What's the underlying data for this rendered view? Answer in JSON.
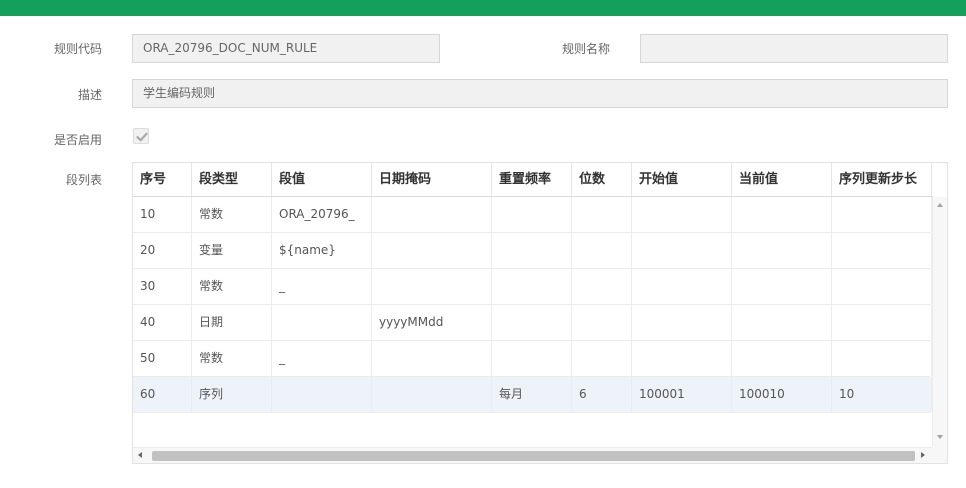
{
  "colors": {
    "accent": "#13a05a"
  },
  "form": {
    "rule_code_label": "规则代码",
    "rule_code_value": "ORA_20796_DOC_NUM_RULE",
    "rule_name_label": "规则名称",
    "rule_name_value": "",
    "description_label": "描述",
    "description_value": "学生编码规则",
    "enabled_label": "是否启用",
    "enabled_checked": true,
    "segments_label": "段列表"
  },
  "table": {
    "columns": [
      "序号",
      "段类型",
      "段值",
      "日期掩码",
      "重置频率",
      "位数",
      "开始值",
      "当前值",
      "序列更新步长"
    ],
    "rows": [
      [
        "10",
        "常数",
        "ORA_20796_",
        "",
        "",
        "",
        "",
        "",
        ""
      ],
      [
        "20",
        "变量",
        "${name}",
        "",
        "",
        "",
        "",
        "",
        ""
      ],
      [
        "30",
        "常数",
        "_",
        "",
        "",
        "",
        "",
        "",
        ""
      ],
      [
        "40",
        "日期",
        "",
        "yyyyMMdd",
        "",
        "",
        "",
        "",
        ""
      ],
      [
        "50",
        "常数",
        "_",
        "",
        "",
        "",
        "",
        "",
        ""
      ],
      [
        "60",
        "序列",
        "",
        "",
        "每月",
        "6",
        "100001",
        "100010",
        "10"
      ]
    ],
    "selected_row": 5
  },
  "icons": {
    "checkbox": "check-icon",
    "scroll_up": "arrow-up-icon",
    "scroll_down": "arrow-down-icon",
    "scroll_left": "arrow-left-icon",
    "scroll_right": "arrow-right-icon"
  }
}
